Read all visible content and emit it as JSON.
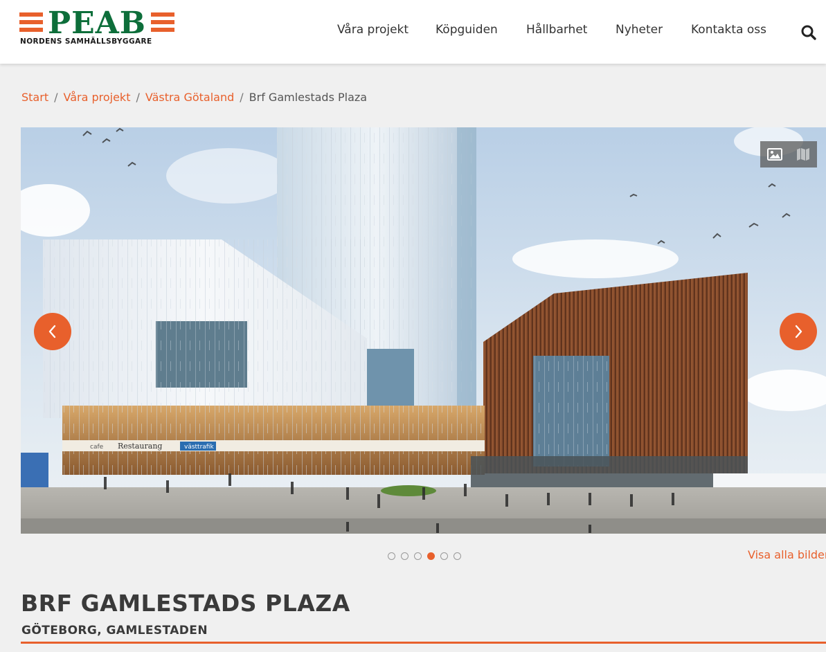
{
  "header": {
    "logo": {
      "wordmark": "PEAB",
      "tagline": "NORDENS SAMHÄLLSBYGGARE"
    },
    "nav": [
      {
        "label": "Våra projekt"
      },
      {
        "label": "Köpguiden"
      },
      {
        "label": "Hållbarhet"
      },
      {
        "label": "Nyheter"
      },
      {
        "label": "Kontakta oss"
      }
    ],
    "search_icon": "search-icon"
  },
  "breadcrumb": {
    "items": [
      "Start",
      "Våra projekt",
      "Västra Götaland"
    ],
    "separator": "/",
    "current": "Brf Gamlestads Plaza"
  },
  "carousel": {
    "image_alt": "Brf Gamlestads Plaza",
    "signage": {
      "cafe": "cafe",
      "restaurant": "Restaurang",
      "transit": "västtrafik"
    },
    "view_toggle": [
      {
        "icon": "image-icon",
        "active": true
      },
      {
        "icon": "map-icon",
        "active": false
      }
    ],
    "prev_icon": "chevron-left-icon",
    "next_icon": "chevron-right-icon",
    "slide_count": 6,
    "active_slide_index": 3,
    "show_all_label": "Visa alla bilder"
  },
  "project": {
    "title": "BRF GAMLESTADS PLAZA",
    "subtitle": "GÖTEBORG, GAMLESTADEN"
  },
  "colors": {
    "accent": "#e8602c",
    "logo_orange": "#e8602c",
    "logo_green": "#0d6e3a",
    "text_dark": "#3a3a3a",
    "page_bg": "#f0f0f0"
  }
}
